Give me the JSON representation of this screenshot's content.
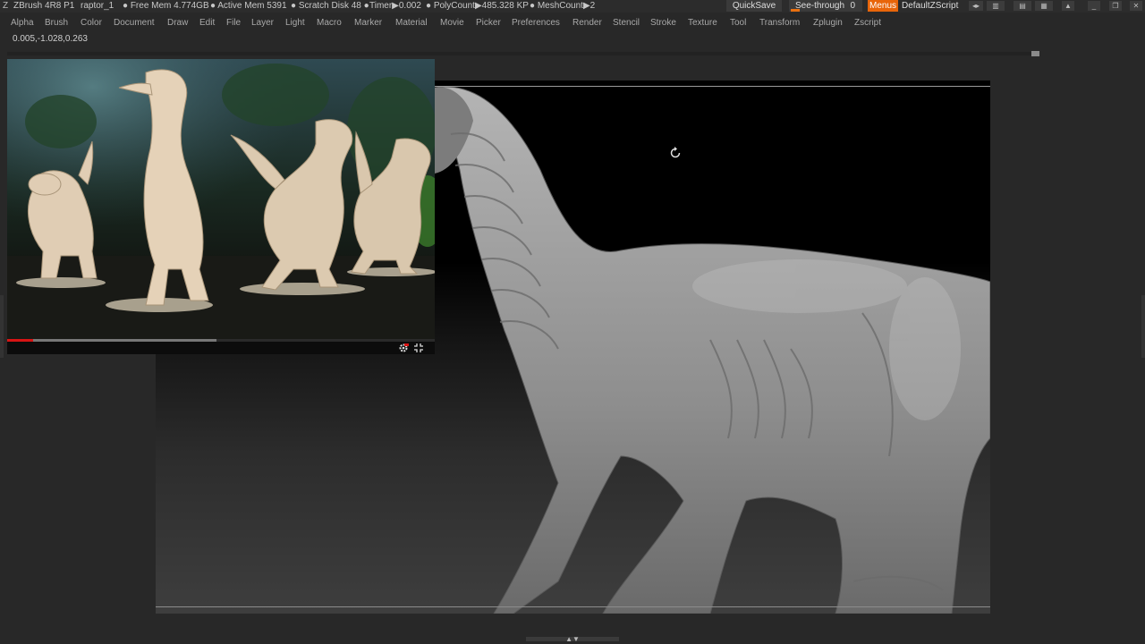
{
  "titlebar": {
    "app": "ZBrush 4R8 P1",
    "document": "raptor_1",
    "free_mem": "● Free Mem 4.774GB",
    "active_mem": "● Active Mem 5391",
    "scratch_disk": "● Scratch Disk 48 ●",
    "timer": "Timer▶0.002",
    "polycount": "● PolyCount▶485.328 KP",
    "meshcount": "● MeshCount▶2",
    "quicksave": "QuickSave",
    "seethrough_label": "See-through",
    "seethrough_value": "0",
    "menus": "Menus",
    "default_zscript": "DefaultZScript"
  },
  "menus": [
    "Alpha",
    "Brush",
    "Color",
    "Document",
    "Draw",
    "Edit",
    "File",
    "Layer",
    "Light",
    "Macro",
    "Marker",
    "Material",
    "Movie",
    "Picker",
    "Preferences",
    "Render",
    "Stencil",
    "Stroke",
    "Texture",
    "Tool",
    "Transform",
    "Zplugin",
    "Zscript"
  ],
  "coords": "0.005,-1.028,0.263",
  "video": {
    "progress": 0.06,
    "buffered": 0.49
  },
  "colors": {
    "accent": "#e8650a",
    "video_progress": "#d81414",
    "canvas_bg": "#000000",
    "ui_bg": "#282828"
  },
  "icons": {
    "logo": "zbrush-logo-icon",
    "rotate": "rotate-icon",
    "settings": "gear-icon",
    "fullscreen": "fullscreen-icon"
  }
}
